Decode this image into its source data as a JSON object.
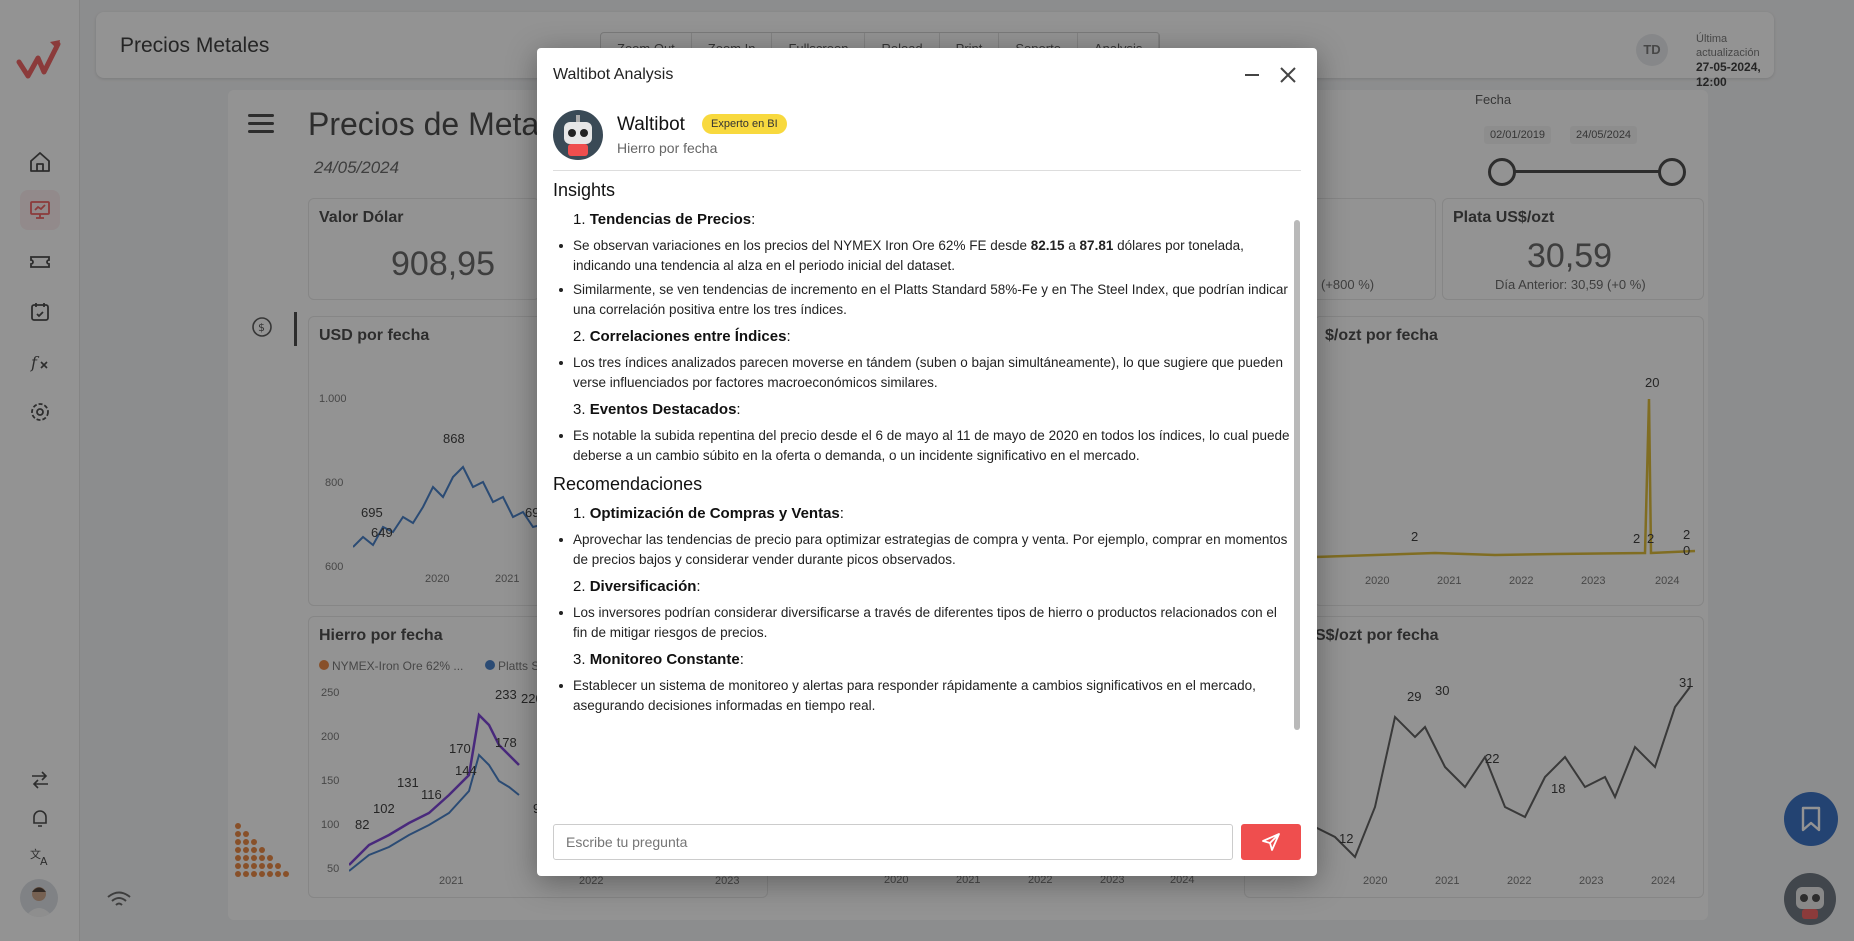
{
  "app": {
    "title": "Precios Metales"
  },
  "toolbar": [
    {
      "label": "Zoom Out"
    },
    {
      "label": "Zoom In"
    },
    {
      "label": "Fullscreen"
    },
    {
      "label": "Reload"
    },
    {
      "label": "Print"
    },
    {
      "label": "Soporte"
    },
    {
      "label": "Analysis"
    }
  ],
  "user": {
    "initials": "TD",
    "updated_label": "Última actualización",
    "updated_value": "27-05-2024, 12:00"
  },
  "page": {
    "title": "Precios de Metales",
    "date": "24/05/2024"
  },
  "filter": {
    "label": "Fecha",
    "start": "02/01/2019",
    "end": "24/05/2024"
  },
  "cards": {
    "dolar": {
      "title": "Valor Dólar",
      "value": "908,95"
    },
    "plata": {
      "title": "Plata US$/ozt",
      "value": "30,59",
      "prev": "Día Anterior: 30,59 (+0 %)"
    },
    "pct": {
      "text": "(+800 %)"
    }
  },
  "charts": {
    "usd": {
      "title": "USD por fecha",
      "y_ticks": [
        "1.000",
        "800",
        "600"
      ],
      "x_ticks": [
        "2020",
        "2021"
      ],
      "labels": [
        "868",
        "695",
        "649",
        "69"
      ]
    },
    "plata_fecha": {
      "title": "$/ozt por fecha",
      "x_ticks": [
        "2020",
        "2021",
        "2022",
        "2023",
        "2024"
      ],
      "labels": [
        "20",
        "2",
        "2",
        "2",
        "2",
        "0"
      ]
    },
    "hierro": {
      "title": "Hierro por fecha",
      "legend": [
        "NYMEX-Iron Ore 62% ...",
        "Platts S"
      ],
      "y_ticks": [
        "250",
        "200",
        "150",
        "100",
        "50"
      ],
      "x_ticks": [
        "2021",
        "2022",
        "2023"
      ],
      "labels": [
        "233",
        "220",
        "170",
        "178",
        "144",
        "131",
        "116",
        "102",
        "82",
        "9"
      ]
    },
    "plata2": {
      "title": "S$/ozt por fecha",
      "x_ticks": [
        "2020",
        "2021",
        "2022",
        "2023",
        "2024"
      ],
      "labels": [
        "29",
        "30",
        "22",
        "18",
        "12",
        "31"
      ]
    },
    "mid_x_ticks": [
      "2020",
      "2021",
      "2022",
      "2023",
      "2024"
    ]
  },
  "modal": {
    "title": "Waltibot Analysis",
    "bot_name": "Waltibot",
    "badge": "Experto en BI",
    "subtitle": "Hierro por fecha",
    "insights_heading": "Insights",
    "insights": [
      {
        "num": "1.",
        "title": "Tendencias de Precios",
        "bullets": [
          "Se observan variaciones en los precios del NYMEX Iron Ore 62% FE desde 82.15 a 87.81 dólares por tonelada, indicando una tendencia al alza en el periodo inicial del dataset.",
          "Similarmente, se ven tendencias de incremento en el Platts Standard 58%-Fe y en The Steel Index, que podrían indicar una correlación positiva entre los tres índices."
        ]
      },
      {
        "num": "2.",
        "title": "Correlaciones entre Índices",
        "bullets": [
          "Los tres índices analizados parecen moverse en tándem (suben o bajan simultáneamente), lo que sugiere que pueden verse influenciados por factores macroeconómicos similares."
        ]
      },
      {
        "num": "3.",
        "title": "Eventos Destacados",
        "bullets": [
          "Es notable la subida repentina del precio desde el 6 de mayo al 11 de mayo de 2020 en todos los índices, lo cual puede deberse a un cambio súbito en la oferta o demanda, o un incidente significativo en el mercado."
        ]
      }
    ],
    "rec_heading": "Recomendaciones",
    "recs": [
      {
        "num": "1.",
        "title": "Optimización de Compras y Ventas",
        "bullets": [
          "Aprovechar las tendencias de precio para optimizar estrategias de compra y venta. Por ejemplo, comprar en momentos de precios bajos y considerar vender durante picos observados."
        ]
      },
      {
        "num": "2.",
        "title": "Diversificación",
        "bullets": [
          "Los inversores podrían considerar diversificarse a través de diferentes tipos de hierro o productos relacionados con el fin de mitigar riesgos de precios."
        ]
      },
      {
        "num": "3.",
        "title": "Monitoreo Constante",
        "bullets": [
          "Establecer un sistema de monitoreo y alertas para responder rápidamente a cambios significativos en el mercado, asegurando decisiones informadas en tiempo real."
        ]
      }
    ],
    "input_placeholder": "Escribe tu pregunta"
  },
  "colors": {
    "accent": "#ef4e4e",
    "brand_blue": "#1f5fbd",
    "badge": "#f8d93e",
    "line_blue": "#2f6fc0",
    "line_gold": "#d8b21c",
    "line_purple": "#6b2bd1"
  },
  "icons": [
    "home-icon",
    "presentation-icon",
    "ticket-icon",
    "calendar-icon",
    "function-icon",
    "settings-icon",
    "arrows-icon",
    "bell-icon",
    "translate-icon",
    "wifi-icon",
    "bookmark-icon",
    "send-icon",
    "minimize-icon",
    "close-icon",
    "menu-icon",
    "dollar-icon"
  ]
}
